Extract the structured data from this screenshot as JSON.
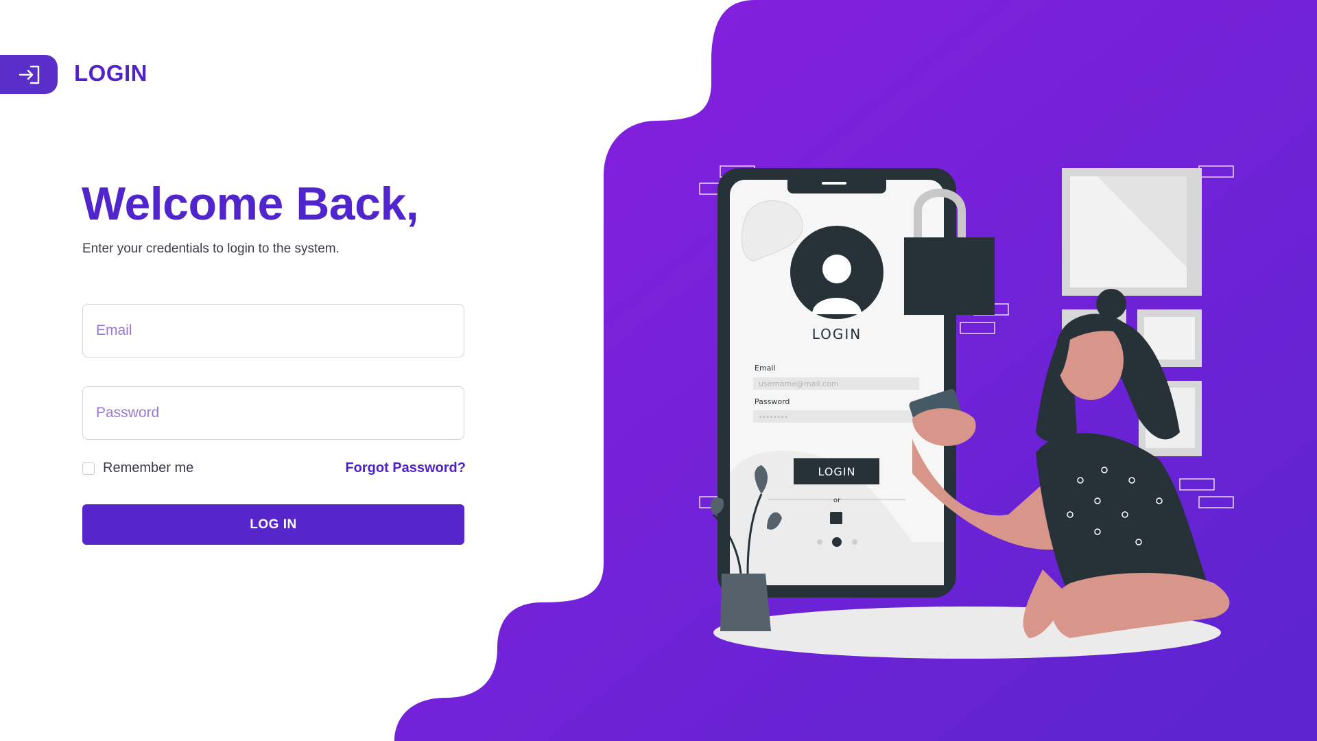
{
  "header": {
    "title": "LOGIN",
    "icon": "login-arrow-icon"
  },
  "form": {
    "heading": "Welcome Back,",
    "subtitle": "Enter your credentials to login to the system.",
    "email_placeholder": "Email",
    "password_placeholder": "Password",
    "remember_label": "Remember me",
    "forgot_label": "Forgot Password?",
    "submit_label": "LOG IN"
  },
  "illustration": {
    "phone_title": "LOGIN",
    "email_label": "Email",
    "email_placeholder": "username@mail.com",
    "password_label": "Password",
    "password_mask": "••••••••",
    "button_label": "LOGIN",
    "or_label": "or"
  },
  "colors": {
    "primary": "#5726cb",
    "gradient_start": "#8a1fe0",
    "gradient_end": "#5b24d0"
  }
}
